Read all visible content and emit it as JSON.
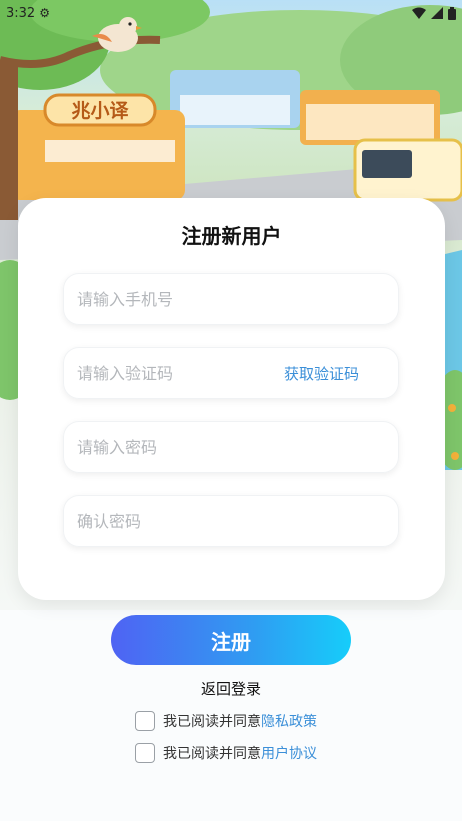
{
  "status": {
    "time": "3:32"
  },
  "hero": {
    "shop_sign": "兆小译"
  },
  "card": {
    "title": "注册新用户",
    "phone_placeholder": "请输入手机号",
    "code_placeholder": "请输入验证码",
    "get_code_label": "获取验证码",
    "password_placeholder": "请输入密码",
    "confirm_placeholder": "确认密码"
  },
  "actions": {
    "register_label": "注册",
    "back_login_label": "返回登录"
  },
  "agreements": [
    {
      "prefix": "我已阅读并同意",
      "link": "隐私政策"
    },
    {
      "prefix": "我已阅读并同意",
      "link": "用户协议"
    }
  ]
}
